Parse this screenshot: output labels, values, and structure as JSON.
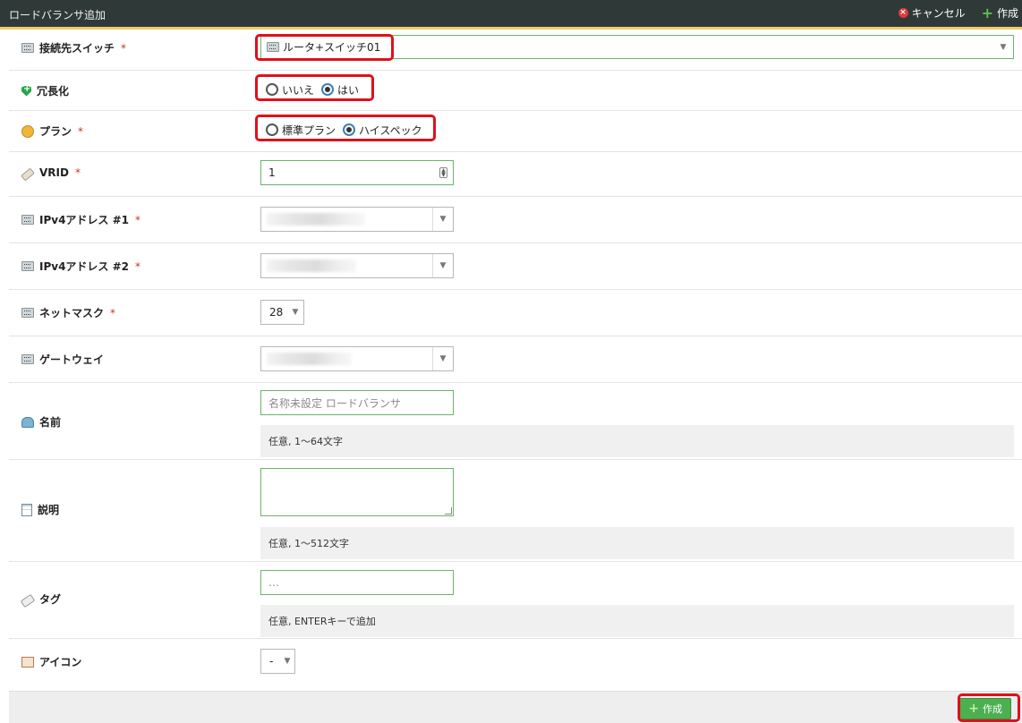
{
  "window": {
    "title": "ロードバランサ追加",
    "cancel_label": "キャンセル",
    "create_label": "作成"
  },
  "form": {
    "switch": {
      "label": "接続先スイッチ",
      "required": "*",
      "value": "ルータ+スイッチ01"
    },
    "redundancy": {
      "label": "冗長化",
      "options": [
        "いいえ",
        "はい"
      ],
      "selected": "はい"
    },
    "plan": {
      "label": "プラン",
      "required": "*",
      "options": [
        "標準プラン",
        "ハイスペック"
      ],
      "selected": "ハイスペック"
    },
    "vrid": {
      "label": "VRID",
      "required": "*",
      "value": "1"
    },
    "ipv4_1": {
      "label": "IPv4アドレス #1",
      "required": "*"
    },
    "ipv4_2": {
      "label": "IPv4アドレス #2",
      "required": "*"
    },
    "netmask": {
      "label": "ネットマスク",
      "required": "*",
      "value": "28"
    },
    "gateway": {
      "label": "ゲートウェイ"
    },
    "name": {
      "label": "名前",
      "placeholder": "名称未設定 ロードバランサ",
      "hint": "任意, 1～64文字"
    },
    "description": {
      "label": "説明",
      "hint": "任意, 1～512文字"
    },
    "tags": {
      "label": "タグ",
      "placeholder": "…",
      "hint": "任意, ENTERキーで追加"
    },
    "icon": {
      "label": "アイコン",
      "value": "-"
    }
  },
  "footer": {
    "create_label": "作成"
  },
  "colors": {
    "header_bg": "#2f3a38",
    "accent": "#f5c869",
    "highlight": "#e0101a",
    "create_button": "#4caf50"
  }
}
